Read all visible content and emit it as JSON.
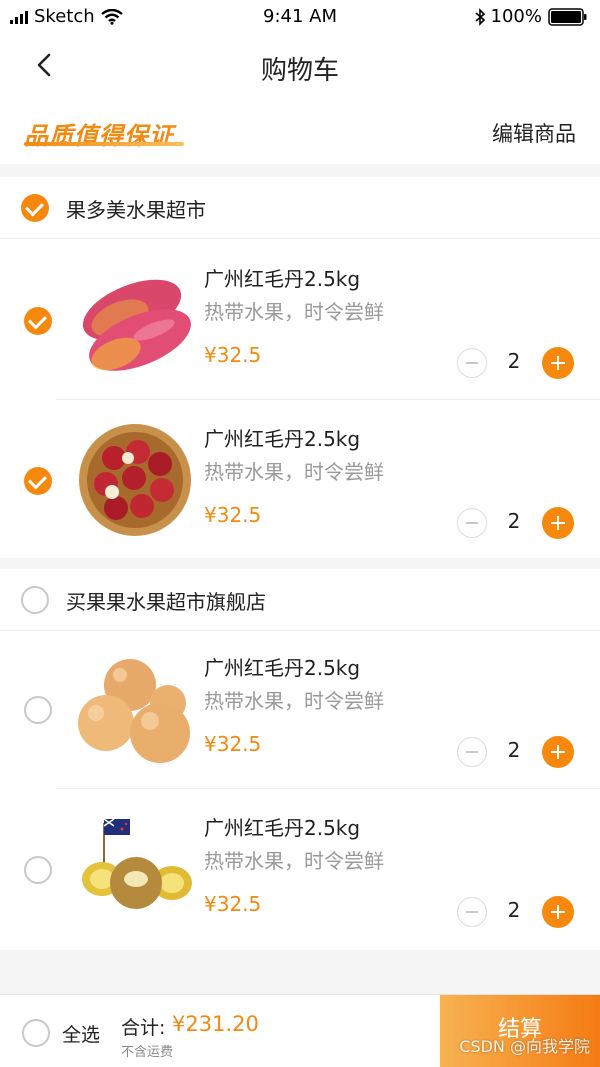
{
  "status_bar": {
    "carrier": "Sketch",
    "time": "9:41 AM",
    "battery": "100%"
  },
  "nav": {
    "title": "购物车"
  },
  "banner": {
    "brand": "品质值得保证",
    "edit_label": "编辑商品"
  },
  "stores": [
    {
      "name": "果多美水果超市",
      "checked": true,
      "items": [
        {
          "name": "广州红毛丹2.5kg",
          "desc": "热带水果，时令尝鲜",
          "price": "¥32.5",
          "qty": "2",
          "checked": true,
          "image_icon": "mango-image"
        },
        {
          "name": "广州红毛丹2.5kg",
          "desc": "热带水果，时令尝鲜",
          "price": "¥32.5",
          "qty": "2",
          "checked": true,
          "image_icon": "rambutan-basket-image"
        }
      ]
    },
    {
      "name": "买果果水果超市旗舰店",
      "checked": false,
      "items": [
        {
          "name": "广州红毛丹2.5kg",
          "desc": "热带水果，时令尝鲜",
          "price": "¥32.5",
          "qty": "2",
          "checked": false,
          "image_icon": "pear-image"
        },
        {
          "name": "广州红毛丹2.5kg",
          "desc": "热带水果，时令尝鲜",
          "price": "¥32.5",
          "qty": "2",
          "checked": false,
          "image_icon": "kiwi-image"
        }
      ]
    }
  ],
  "footer": {
    "select_all": "全选",
    "total_label": "合计:",
    "total_value": "¥231.20",
    "shipping_note": "不含运费",
    "checkout_label": "结算",
    "watermark": "CSDN @向我学院"
  },
  "colors": {
    "accent": "#f6890d",
    "price": "#f08a12",
    "checkout_gradient": [
      "#f7b251",
      "#f57b13"
    ]
  }
}
